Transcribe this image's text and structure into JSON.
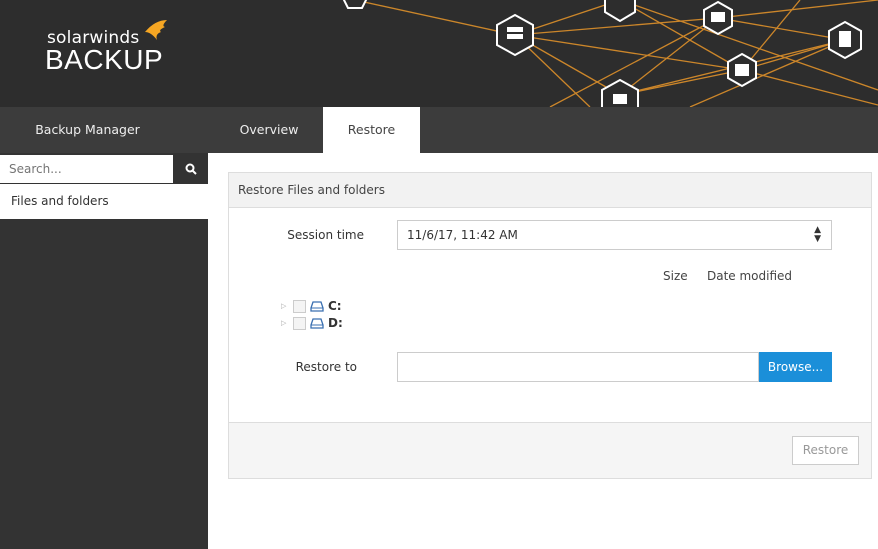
{
  "brand": {
    "top": "solarwinds",
    "bottom": "BACKUP",
    "accent": "#f5a623"
  },
  "nav": {
    "tabs": [
      {
        "label": "Backup Manager"
      },
      {
        "label": "Overview"
      },
      {
        "label": "Restore",
        "active": true
      }
    ]
  },
  "sidebar": {
    "search_placeholder": "Search...",
    "search_icon": "magnifier",
    "items": [
      {
        "label": "Files and folders"
      }
    ]
  },
  "panel": {
    "title": "Restore Files and folders",
    "session_label": "Session time",
    "session_value": "11/6/17, 11:42 AM",
    "columns": [
      "Size",
      "Date modified"
    ],
    "tree": [
      {
        "label": "C:",
        "icon": "drive"
      },
      {
        "label": "D:",
        "icon": "drive"
      }
    ],
    "restore_to_label": "Restore to",
    "restore_to_value": "",
    "browse_label": "Browse...",
    "restore_label": "Restore"
  },
  "colors": {
    "primary": "#1b8fd9",
    "header": "#2d2d2d",
    "nav": "#3c3c3c"
  }
}
